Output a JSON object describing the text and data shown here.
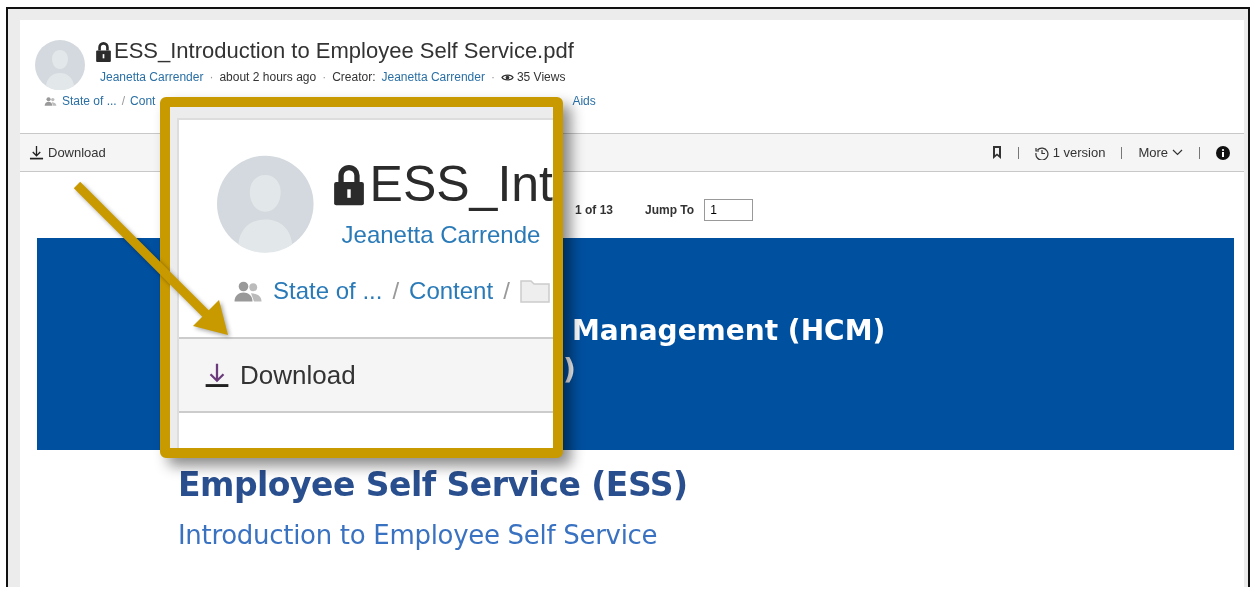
{
  "document": {
    "title": "ESS_Introduction to Employee Self Service.pdf",
    "locked": true,
    "author": "Jeanetta Carrender",
    "dot": "·",
    "time": "about 2 hours ago",
    "creator_label": "Creator:",
    "creator": "Jeanetta Carrender",
    "views": "35 Views",
    "breadcrumb": [
      "State of ...",
      "Cont"
    ],
    "separator": "/",
    "breadcrumb_tail": "Aids"
  },
  "toolbar": {
    "download": "Download",
    "versions": "1 version",
    "more": "More"
  },
  "viewer": {
    "page": "1 of 13",
    "jump_label": "Jump To",
    "jump_value": "1"
  },
  "slide": {
    "banner_lines": [
      "Management (HCM)",
      ")"
    ],
    "heading": "Employee Self Service (ESS)",
    "subheading": "Introduction to Employee Self Service"
  },
  "callout": {
    "title": "ESS_Int",
    "locked": true,
    "author": "Jeanetta Carrende",
    "breadcrumb": [
      "State of ...",
      "Content"
    ],
    "separator": "/",
    "download": "Download"
  }
}
